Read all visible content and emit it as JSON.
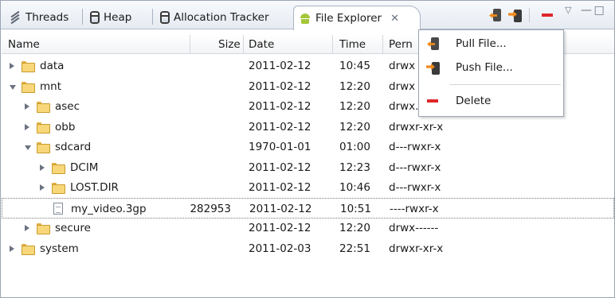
{
  "tabs": [
    {
      "label": "Threads",
      "icon": "threads-icon"
    },
    {
      "label": "Heap",
      "icon": "heap-icon"
    },
    {
      "label": "Allocation Tracker",
      "icon": "allocation-tracker-icon"
    },
    {
      "label": "File Explorer",
      "icon": "android-icon",
      "active": true,
      "close": "✕"
    }
  ],
  "toolbar": {
    "pull_icon": "pull-file-icon",
    "push_icon": "push-file-icon",
    "delete_icon": "delete-icon",
    "view_menu": "▽",
    "minimize": "— □"
  },
  "columns": {
    "name": "Name",
    "size": "Size",
    "date": "Date",
    "time": "Time",
    "permissions": "Pern"
  },
  "rows": [
    {
      "name": "data",
      "size": "",
      "date": "2011-02-12",
      "time": "10:45",
      "perm": "drwx",
      "type": "folder",
      "depth": 0,
      "expanded": false
    },
    {
      "name": "mnt",
      "size": "",
      "date": "2011-02-12",
      "time": "12:20",
      "perm": "drwx",
      "type": "folder",
      "depth": 0,
      "expanded": true
    },
    {
      "name": "asec",
      "size": "",
      "date": "2011-02-12",
      "time": "12:20",
      "perm": "drwx……x",
      "type": "folder",
      "depth": 1,
      "expanded": false
    },
    {
      "name": "obb",
      "size": "",
      "date": "2011-02-12",
      "time": "12:20",
      "perm": "drwxr-xr-x",
      "type": "folder",
      "depth": 1,
      "expanded": false
    },
    {
      "name": "sdcard",
      "size": "",
      "date": "1970-01-01",
      "time": "01:00",
      "perm": "d---rwxr-x",
      "type": "folder",
      "depth": 1,
      "expanded": true
    },
    {
      "name": "DCIM",
      "size": "",
      "date": "2011-02-12",
      "time": "12:23",
      "perm": "d---rwxr-x",
      "type": "folder",
      "depth": 2,
      "expanded": false
    },
    {
      "name": "LOST.DIR",
      "size": "",
      "date": "2011-02-12",
      "time": "10:46",
      "perm": "d---rwxr-x",
      "type": "folder",
      "depth": 2,
      "expanded": false
    },
    {
      "name": "my_video.3gp",
      "size": "282953",
      "date": "2011-02-12",
      "time": "10:51",
      "perm": "----rwxr-x",
      "type": "file",
      "depth": 2,
      "selected": true
    },
    {
      "name": "secure",
      "size": "",
      "date": "2011-02-12",
      "time": "12:20",
      "perm": "drwx------",
      "type": "folder",
      "depth": 1,
      "expanded": false
    },
    {
      "name": "system",
      "size": "",
      "date": "2011-02-03",
      "time": "22:51",
      "perm": "drwxr-xr-x",
      "type": "folder",
      "depth": 0,
      "expanded": false
    }
  ],
  "context_menu": {
    "pull": "Pull File...",
    "push": "Push File...",
    "delete": "Delete"
  },
  "colors": {
    "delete_red": "#e0262b",
    "folder_yellow": "#f8d77a",
    "arrow_orange": "#f08a1c"
  }
}
